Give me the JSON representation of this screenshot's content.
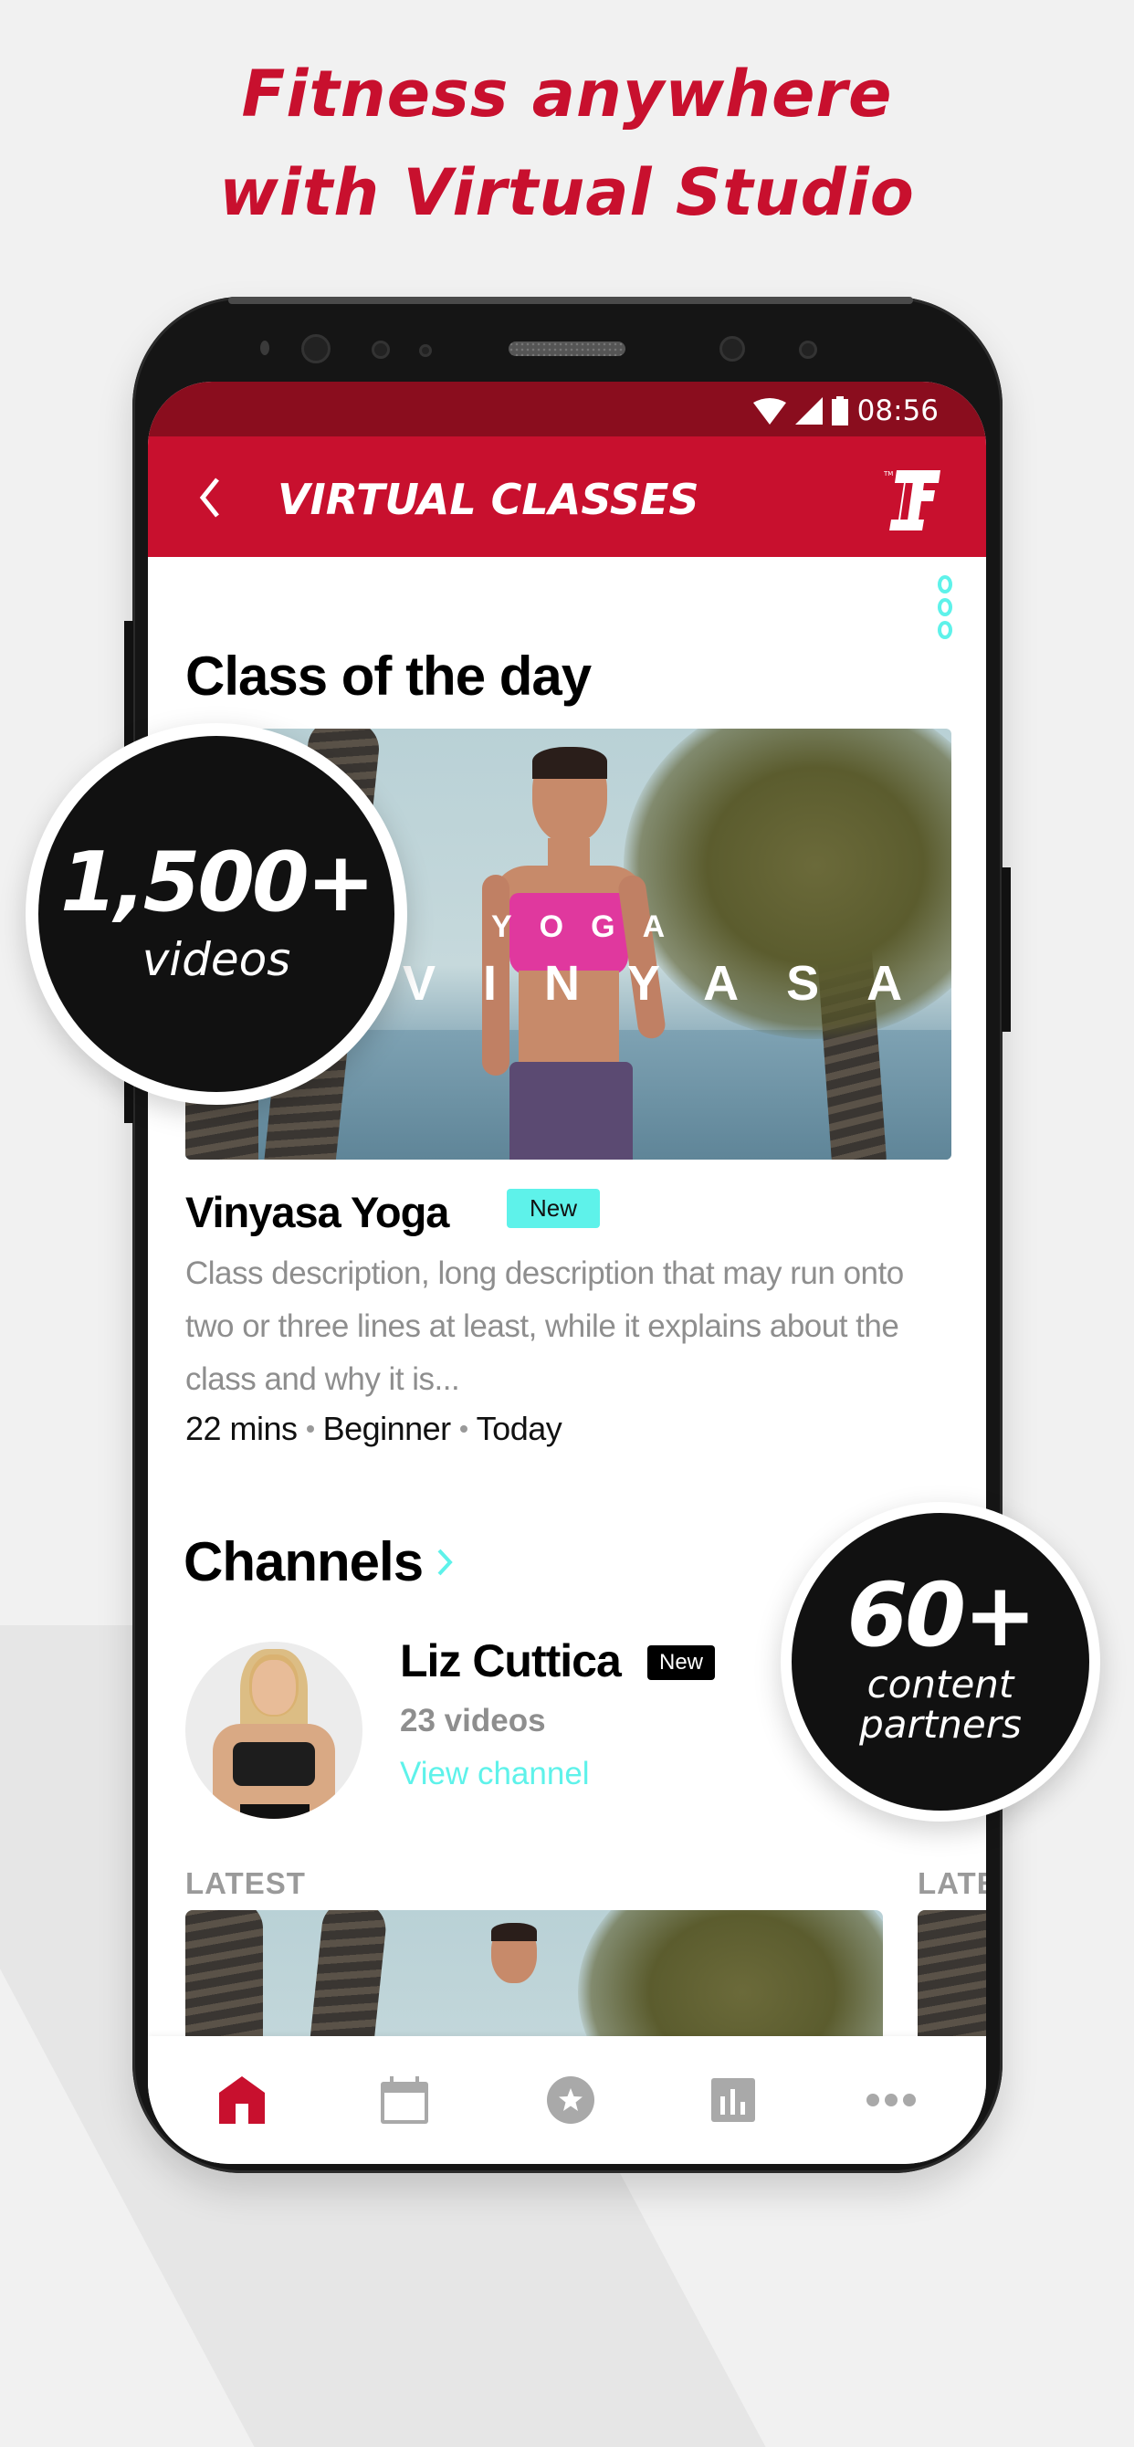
{
  "promo": {
    "headline_line1": "Fitness anywhere",
    "headline_line2": "with Virtual Studio",
    "accent_color": "#c8102e",
    "stat_videos": {
      "value": "1,500+",
      "label": "videos"
    },
    "stat_partners": {
      "value": "60+",
      "label_line1": "content",
      "label_line2": "partners"
    }
  },
  "status_bar": {
    "time": "08:56",
    "icons": [
      "wifi-icon",
      "signal-icon",
      "battery-icon"
    ]
  },
  "app_bar": {
    "title": "VIRTUAL CLASSES",
    "back_icon": "chevron-left-icon",
    "logo": "F"
  },
  "class_of_day": {
    "section_title": "Class of the day",
    "image_overlay_top": "YOGA",
    "image_overlay_main": "VINYASA",
    "title": "Vinyasa Yoga",
    "badge": "New",
    "description": "Class description, long description that may run onto two or three lines at least, while it explains about the class and why it is...",
    "duration": "22 mins",
    "level": "Beginner",
    "date": "Today"
  },
  "channels": {
    "section_title": "Channels",
    "items": [
      {
        "name": "Liz Cuttica",
        "badge": "New",
        "count": "23 videos",
        "link": "View channel"
      }
    ]
  },
  "latest": {
    "label": "LATEST",
    "label_partial": "LATE"
  },
  "bottom_nav": {
    "items": [
      {
        "name": "home",
        "icon": "home-icon",
        "active": true
      },
      {
        "name": "schedule",
        "icon": "calendar-icon",
        "active": false
      },
      {
        "name": "favorites",
        "icon": "star-icon",
        "active": false
      },
      {
        "name": "stats",
        "icon": "bar-chart-icon",
        "active": false
      },
      {
        "name": "more",
        "icon": "more-horizontal-icon",
        "active": false
      }
    ],
    "active_color": "#c8102e",
    "inactive_color": "#a9a9a9"
  },
  "colors": {
    "status_bar": "#8a0d1e",
    "app_bar": "#c8102e",
    "cyan_accent": "#5ef2ea"
  }
}
